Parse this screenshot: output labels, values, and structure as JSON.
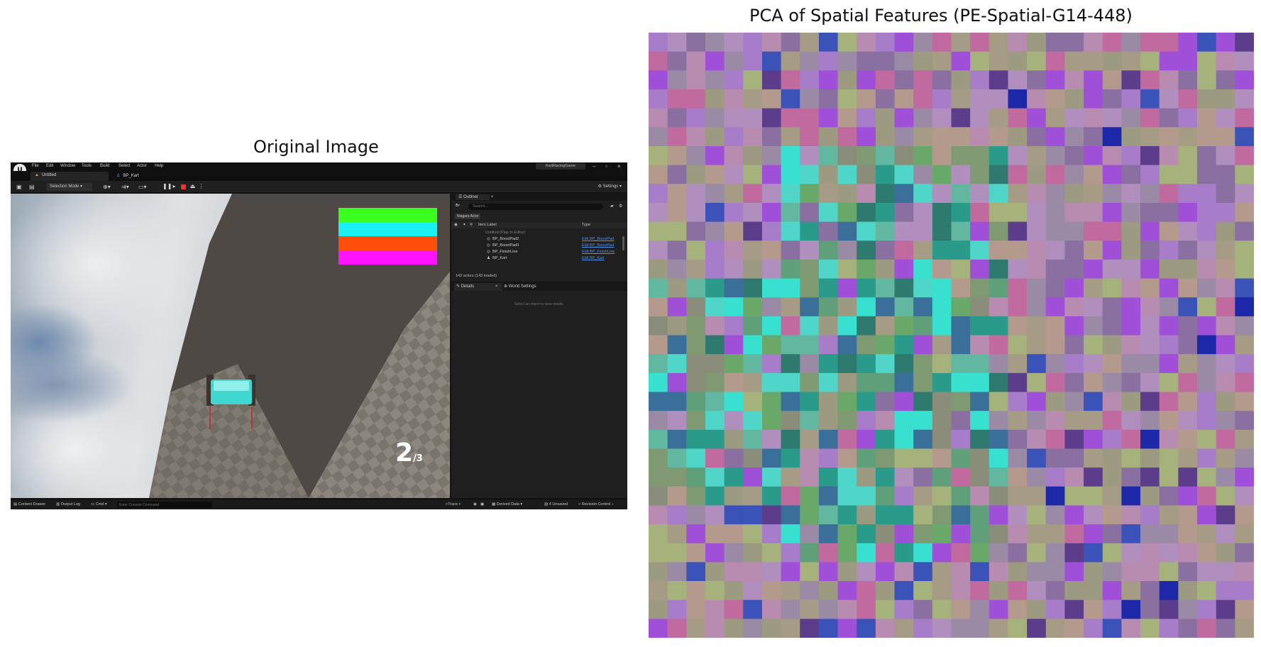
{
  "left_title": "Original Image",
  "right_title": "PCA of Spatial Features (PE-Spatial-G14-448)",
  "editor": {
    "menu": [
      "File",
      "Edit",
      "Window",
      "Tools",
      "Build",
      "Select",
      "Actor",
      "Help"
    ],
    "project_name": "KartRacingGame",
    "tabs": [
      "Untitled",
      "BP_Kart"
    ],
    "toolbar": {
      "selection_mode": "Selection Mode",
      "settings": "Settings"
    },
    "hud": {
      "lap_current": "2",
      "lap_total": "/3",
      "colors": [
        "#3bff1c",
        "#19f1f1",
        "#ff4e0c",
        "#ff14ff"
      ]
    },
    "outliner": {
      "title": "Outliner",
      "search_placeholder": "Search...",
      "niagara": "Niagara Actor",
      "col_label": "Item Label",
      "col_type": "Type",
      "rows": [
        {
          "name": "Untitled (Play In Editor)",
          "type": ""
        },
        {
          "name": "BP_BoostPad2",
          "type": "Edit BP_BoostPad"
        },
        {
          "name": "BP_BoostPad3",
          "type": "Edit BP_BoostPad"
        },
        {
          "name": "BP_FinishLine",
          "type": "Edit BP_FinishLine"
        },
        {
          "name": "BP_Kart",
          "type": "Edit BP_Kart"
        }
      ],
      "actor_count": "143 actors (143 loaded)"
    },
    "details": {
      "tab": "Details",
      "world_settings": "World Settings",
      "empty": "Select an object to view details."
    },
    "status_bar": {
      "content_drawer": "Content Drawer",
      "output_log": "Output Log",
      "cmd": "Cmd",
      "console_placeholder": "Enter Console Command",
      "trace": "Trace",
      "derived_data": "Derived Data",
      "unsaved": "4 Unsaved",
      "revision_control": "Revision Control"
    }
  },
  "pca_grid": {
    "cols": 32,
    "rows": 32,
    "palette": [
      "#b49a8c",
      "#b88cb0",
      "#a69c86",
      "#9c9a80",
      "#b08fbe",
      "#a77cc8",
      "#8a8d7a",
      "#7f9a72",
      "#6aa86a",
      "#5fa07a",
      "#62b7a0",
      "#4fd6c8",
      "#38e0d0",
      "#2a9a8a",
      "#2f7a6f",
      "#3a6f9a",
      "#3b52b8",
      "#1c28a8",
      "#5c3d8c",
      "#8a70a0",
      "#a6b27c",
      "#8aa860",
      "#7eb15a",
      "#c06aa0",
      "#a050d8",
      "#9a8aa6",
      "#7a9aa8",
      "#5d8ec0",
      "#46c8a0",
      "#4a6a58"
    ]
  }
}
